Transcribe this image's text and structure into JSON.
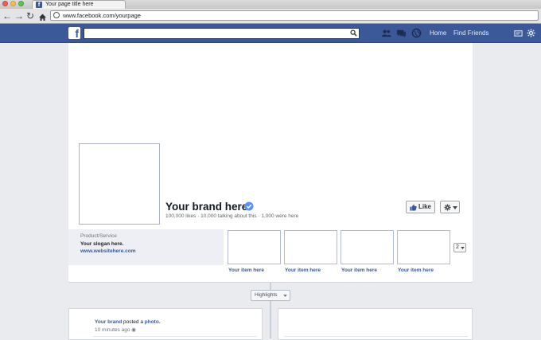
{
  "browser": {
    "tab_title": "Your page title here",
    "url": "www.facebook.com/yourpage"
  },
  "topbar": {
    "logo": "f",
    "nav_home": "Home",
    "nav_find_friends": "Find Friends"
  },
  "page": {
    "brand_name": "Your brand here",
    "stats": "100,000 likes · 10,000 talking about this · 1,000 were here",
    "like_label": "Like",
    "about": {
      "category": "Product/Service",
      "slogan": "Your slogan here.",
      "website": "www.websitehere.com"
    },
    "apps": [
      {
        "label": "Your item here"
      },
      {
        "label": "Your item here"
      },
      {
        "label": "Your item here"
      },
      {
        "label": "Your item here"
      }
    ],
    "more_count": "2"
  },
  "timeline": {
    "highlights_label": "Highlights",
    "post": {
      "author": "Your brand",
      "action": " posted a ",
      "object": "photo.",
      "time": "10 minutes ago"
    }
  },
  "colors": {
    "fb_blue": "#3b5998",
    "link": "#3b5998",
    "background": "#e9ebee"
  }
}
